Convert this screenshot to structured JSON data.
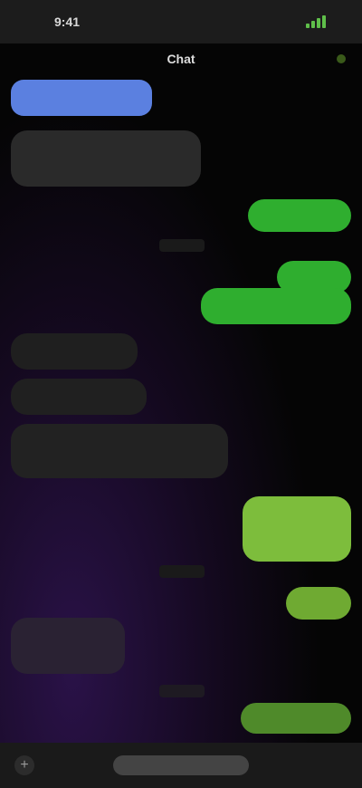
{
  "status_bar": {
    "time": "9:41",
    "signal_color": "#5fbf4a"
  },
  "header": {
    "contact_name": "Chat"
  },
  "messages": [],
  "composer": {
    "placeholder": "",
    "add_icon": "plus-icon"
  },
  "colors": {
    "outgoing": "#2fae2f",
    "outgoing_light": "#7dbd3c",
    "incoming": "#2a2a2a",
    "link": "#5b80e0",
    "background": "#050505"
  }
}
